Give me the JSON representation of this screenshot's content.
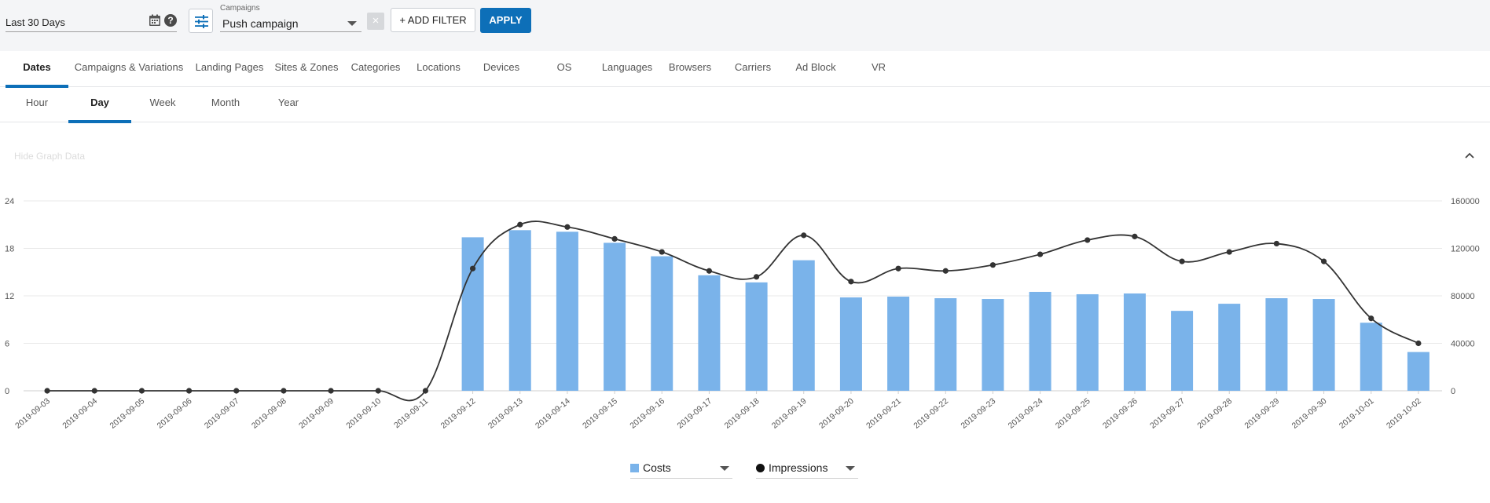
{
  "filters": {
    "date_range": "Last 30 Days",
    "campaigns_label": "Campaigns",
    "campaigns_value": "Push campaign",
    "clear_label": "×",
    "add_filter_label": "+ ADD FILTER",
    "apply_label": "APPLY",
    "help_label": "?"
  },
  "main_tabs": [
    "Dates",
    "Campaigns & Variations",
    "Landing Pages",
    "Sites & Zones",
    "Categories",
    "Locations",
    "Devices",
    "OS",
    "Languages",
    "Browsers",
    "Carriers",
    "Ad Block",
    "VR"
  ],
  "main_tabs_active": "Dates",
  "sub_tabs": [
    "Hour",
    "Day",
    "Week",
    "Month",
    "Year"
  ],
  "sub_tabs_active": "Day",
  "graph": {
    "hide_label": "Hide Graph Data"
  },
  "colors": {
    "accent": "#0d6fb8",
    "costs": "#7ab3ea",
    "impressions": "#333333"
  },
  "chart_data": {
    "type": "bar",
    "categories": [
      "2019-09-03",
      "2019-09-04",
      "2019-09-05",
      "2019-09-06",
      "2019-09-07",
      "2019-09-08",
      "2019-09-09",
      "2019-09-10",
      "2019-09-11",
      "2019-09-12",
      "2019-09-13",
      "2019-09-14",
      "2019-09-15",
      "2019-09-16",
      "2019-09-17",
      "2019-09-18",
      "2019-09-19",
      "2019-09-20",
      "2019-09-21",
      "2019-09-22",
      "2019-09-23",
      "2019-09-24",
      "2019-09-25",
      "2019-09-26",
      "2019-09-27",
      "2019-09-28",
      "2019-09-29",
      "2019-09-30",
      "2019-10-01",
      "2019-10-02"
    ],
    "series": [
      {
        "name": "Costs",
        "type": "bar",
        "axis": "left",
        "values": [
          0,
          0,
          0,
          0,
          0,
          0,
          0,
          0,
          0,
          19.4,
          20.3,
          20.1,
          18.7,
          17.0,
          14.6,
          13.7,
          16.5,
          11.8,
          11.9,
          11.7,
          11.6,
          12.5,
          12.2,
          12.3,
          10.1,
          11.0,
          11.7,
          11.6,
          8.6,
          4.9
        ]
      },
      {
        "name": "Impressions",
        "type": "line",
        "axis": "right",
        "values": [
          0,
          0,
          0,
          0,
          0,
          0,
          0,
          0,
          0,
          103000,
          140000,
          138000,
          128000,
          117000,
          101000,
          96000,
          131000,
          92000,
          103000,
          101000,
          106000,
          115000,
          127000,
          130000,
          109000,
          117000,
          124000,
          109000,
          61000,
          40000
        ]
      }
    ],
    "yleft": {
      "ticks": [
        "0",
        "6",
        "12",
        "18",
        "24"
      ],
      "ylim": [
        0,
        24
      ]
    },
    "yright": {
      "ticks": [
        "0",
        "40000",
        "80000",
        "120000",
        "160000"
      ],
      "ylim": [
        0,
        160000
      ]
    },
    "legend": [
      "Costs",
      "Impressions"
    ],
    "legend_position": "bottom-center",
    "grid": true
  }
}
